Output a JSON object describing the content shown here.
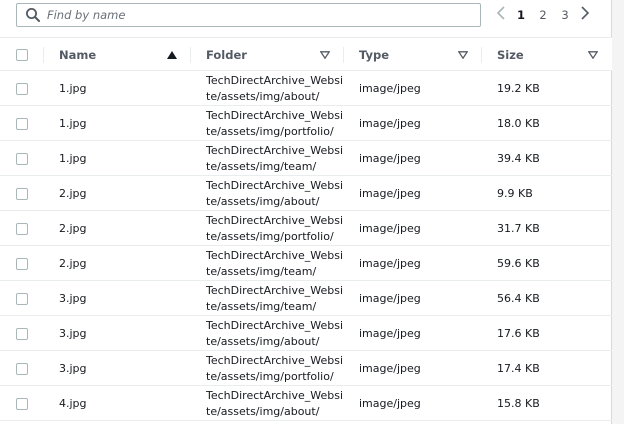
{
  "search": {
    "placeholder": "Find by name",
    "value": ""
  },
  "pagination": {
    "pages": [
      "1",
      "2",
      "3"
    ],
    "current": "1"
  },
  "table": {
    "columns": {
      "name": "Name",
      "folder": "Folder",
      "type": "Type",
      "size": "Size"
    },
    "sort": {
      "column": "Name",
      "direction": "ascending"
    },
    "rows": [
      {
        "name": "1.jpg",
        "folder": "TechDirectArchive_Websi\nte/assets/img/about/",
        "type": "image/jpeg",
        "size": "19.2 KB"
      },
      {
        "name": "1.jpg",
        "folder": "TechDirectArchive_Websi\nte/assets/img/portfolio/",
        "type": "image/jpeg",
        "size": "18.0 KB"
      },
      {
        "name": "1.jpg",
        "folder": "TechDirectArchive_Websi\nte/assets/img/team/",
        "type": "image/jpeg",
        "size": "39.4 KB"
      },
      {
        "name": "2.jpg",
        "folder": "TechDirectArchive_Websi\nte/assets/img/about/",
        "type": "image/jpeg",
        "size": "9.9 KB"
      },
      {
        "name": "2.jpg",
        "folder": "TechDirectArchive_Websi\nte/assets/img/portfolio/",
        "type": "image/jpeg",
        "size": "31.7 KB"
      },
      {
        "name": "2.jpg",
        "folder": "TechDirectArchive_Websi\nte/assets/img/team/",
        "type": "image/jpeg",
        "size": "59.6 KB"
      },
      {
        "name": "3.jpg",
        "folder": "TechDirectArchive_Websi\nte/assets/img/team/",
        "type": "image/jpeg",
        "size": "56.4 KB"
      },
      {
        "name": "3.jpg",
        "folder": "TechDirectArchive_Websi\nte/assets/img/about/",
        "type": "image/jpeg",
        "size": "17.6 KB"
      },
      {
        "name": "3.jpg",
        "folder": "TechDirectArchive_Websi\nte/assets/img/portfolio/",
        "type": "image/jpeg",
        "size": "17.4 KB"
      },
      {
        "name": "4.jpg",
        "folder": "TechDirectArchive_Websi\nte/assets/img/about/",
        "type": "image/jpeg",
        "size": "15.8 KB"
      }
    ]
  },
  "icons": {
    "search": "search-icon",
    "prev": "chevron-left-icon",
    "next": "chevron-right-icon",
    "sort_asc": "sort-ascending-icon",
    "sort_none": "sort-caret-down-icon"
  },
  "colors": {
    "text": "#16191f",
    "secondary_text": "#545b64",
    "border": "#eaeded",
    "input_border": "#aab7b8"
  }
}
